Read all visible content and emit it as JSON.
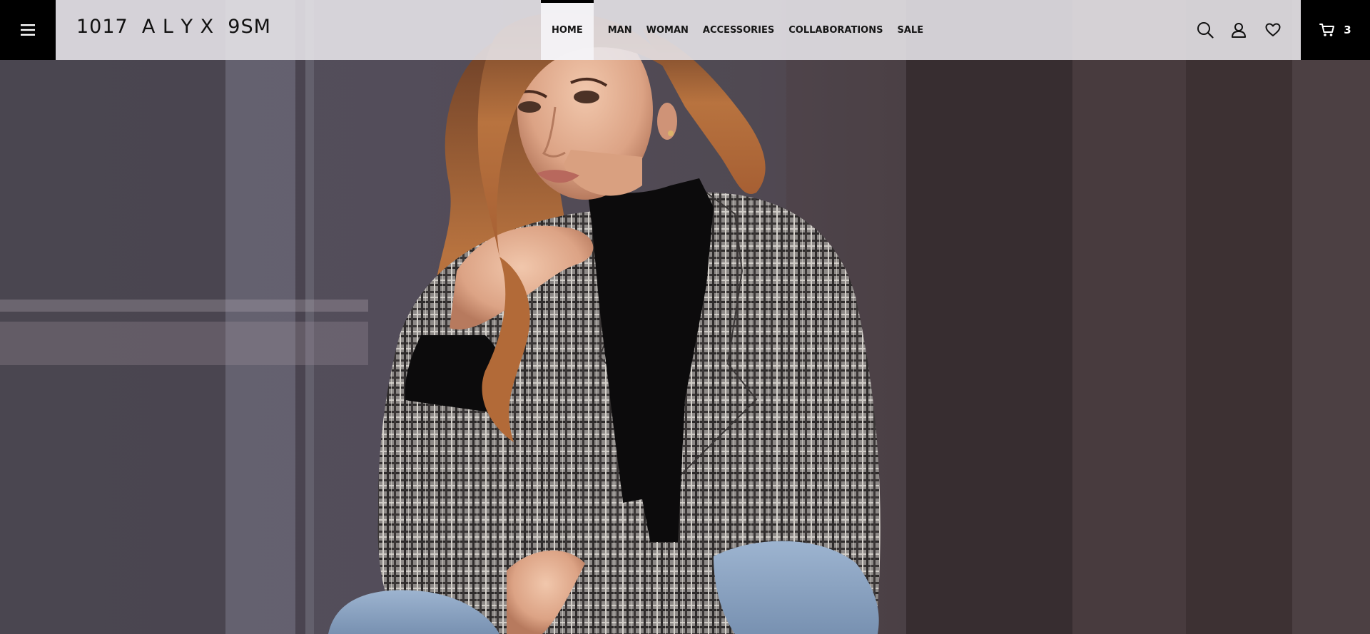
{
  "header": {
    "brand": "1017  A L Y X  9SM",
    "nav": [
      {
        "label": "HOME",
        "active": true
      },
      {
        "label": "MAN",
        "active": false
      },
      {
        "label": "WOMAN",
        "active": false
      },
      {
        "label": "ACCESSORIES",
        "active": false
      },
      {
        "label": "COLLABORATIONS",
        "active": false
      },
      {
        "label": "SALE",
        "active": false
      }
    ],
    "cart_count": "3",
    "icons": {
      "menu": "hamburger-menu-icon",
      "search": "search-icon",
      "account": "user-icon",
      "wishlist": "heart-icon",
      "cart": "shopping-cart-icon"
    }
  },
  "hero": {
    "image": "model-in-plaid-blazer",
    "colors": {
      "header_bg": "#e8e6eb",
      "accent": "#000000",
      "background_left": "#4a4650",
      "background_right": "#3a3033"
    }
  }
}
